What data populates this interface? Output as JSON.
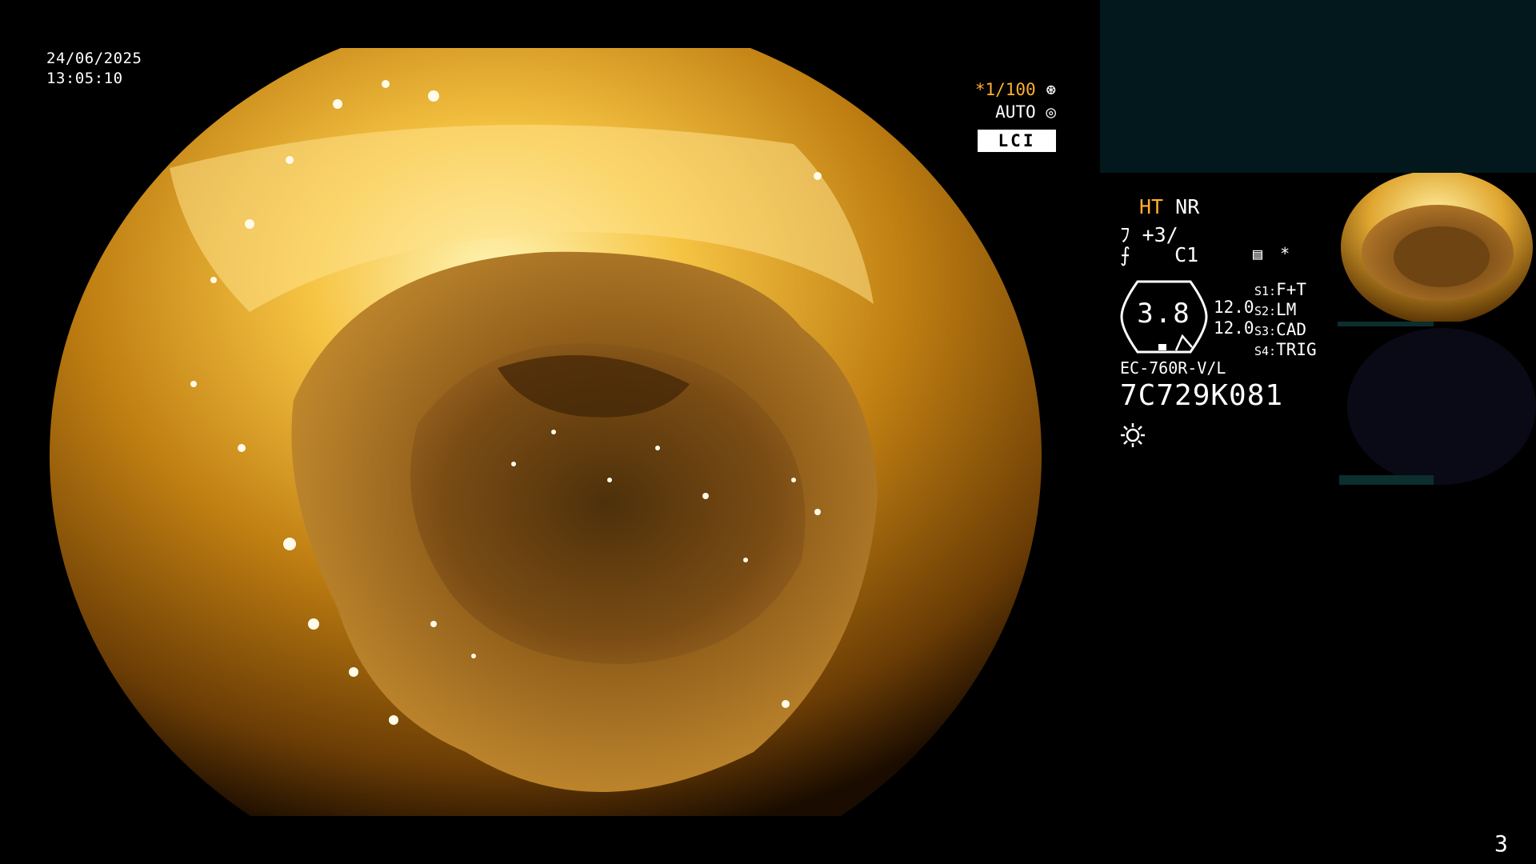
{
  "overlay": {
    "date": "24/06/2025",
    "time": "13:05:10",
    "shutter": "*1/100",
    "shutter_icon": "aperture-icon",
    "auto": "AUTO",
    "auto_icon": "iris-icon",
    "mode": "LCI"
  },
  "panel": {
    "ht": "HT",
    "nr": "NR",
    "enhance": "+3/",
    "color": "C1",
    "star": "*",
    "gauge_value": "3.8",
    "values": [
      "12.0",
      "12.0"
    ],
    "switches": [
      {
        "key": "S1:",
        "value": "F+T"
      },
      {
        "key": "S2:",
        "value": "LM"
      },
      {
        "key": "S3:",
        "value": "CAD"
      },
      {
        "key": "S4:",
        "value": "TRIG"
      }
    ],
    "model": "EC-760R-V/L",
    "serial": "7C729K081"
  },
  "page_number": "3",
  "colors": {
    "accent": "#ffb02e",
    "teal_panel": "#03181c"
  }
}
